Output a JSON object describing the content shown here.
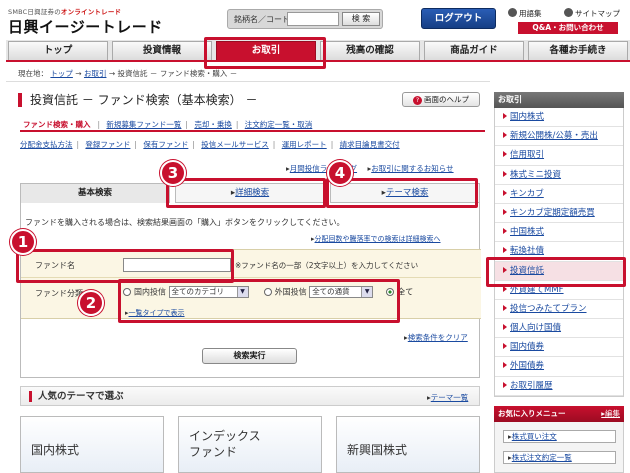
{
  "header": {
    "brand_sub_prefix": "SMBC日興証券の",
    "brand_sub_highlight": "オンライントレード",
    "brand_name": "日興イージートレード",
    "search_label": "銘柄名／コード",
    "search_button": "検 索",
    "logout": "ログアウト",
    "glossary": "用語集",
    "sitemap": "サイトマップ",
    "qa": "Q&A・お問い合わせ"
  },
  "nav": {
    "tabs": [
      {
        "label": "トップ"
      },
      {
        "label": "投資情報"
      },
      {
        "label": "お取引"
      },
      {
        "label": "残高の確認"
      },
      {
        "label": "商品ガイド"
      },
      {
        "label": "各種お手続き"
      }
    ]
  },
  "breadcrumb": {
    "prefix": "現在地：",
    "top": "トップ",
    "arrow": "→",
    "trade": "お取引",
    "current": "投資信託 － ファンド検索・購入 －"
  },
  "page": {
    "title": "投資信託 － ファンド検索（基本検索） －",
    "help": "画面のヘルプ",
    "subtabs": [
      "ファンド検索・購入",
      "新規募集ファンド一覧",
      "売却・乗換",
      "注文約定一覧・取消"
    ],
    "sublinks": [
      "分配金支払方法",
      "登録ファンド",
      "保有ファンド",
      "投信メールサービス",
      "運用レポート",
      "請求目論見書交付"
    ],
    "top_links": [
      "月間投信ランキング",
      "お取引に関するお知らせ"
    ]
  },
  "search": {
    "tabs": [
      "基本検索",
      "詳細検索",
      "テーマ検索"
    ],
    "instruction": "ファンドを購入される場合は、検索結果画面の「購入」ボタンをクリックしてください。",
    "advanced_link": "分配回数や騰落率での検索は詳細検索へ",
    "fund_name_label": "ファンド名",
    "fund_name_value": "",
    "fund_name_hint": "※ファンド名の一部（2文字以上）を入力してください",
    "category_label": "ファンド分類",
    "domestic": "国内投信",
    "domestic_select": "全てのカテゴリ",
    "foreign": "外国投信",
    "foreign_select": "全ての通貨",
    "all": "全て",
    "list_link": "一覧タイプで表示",
    "clear_link": "検索条件をクリア",
    "execute": "検索実行"
  },
  "theme": {
    "title": "人気のテーマで選ぶ",
    "list_link": "テーマ一覧",
    "cards": [
      "国内株式",
      "インデックス",
      "ファンド",
      "新興国株式"
    ]
  },
  "sidebar": {
    "heading": "お取引",
    "items": [
      "国内株式",
      "新規公開株/公募・売出",
      "信用取引",
      "株式ミニ投資",
      "キンカブ",
      "キンカブ定期定額売買",
      "中国株式",
      "転換社債",
      "投資信託",
      "外貨建てMMF",
      "投信つみたてプラン",
      "個人向け国債",
      "国内債券",
      "外国債券",
      "お取引履歴"
    ],
    "fav_heading": "お気に入りメニュー",
    "fav_edit": "編集",
    "fav_items": [
      "株式買い注文",
      "株式注文約定一覧"
    ]
  },
  "callouts": [
    "1",
    "2",
    "3",
    "4"
  ],
  "colors": {
    "accent": "#c8102e",
    "link": "#1a4aa0",
    "logout": "#1f4f9f"
  }
}
